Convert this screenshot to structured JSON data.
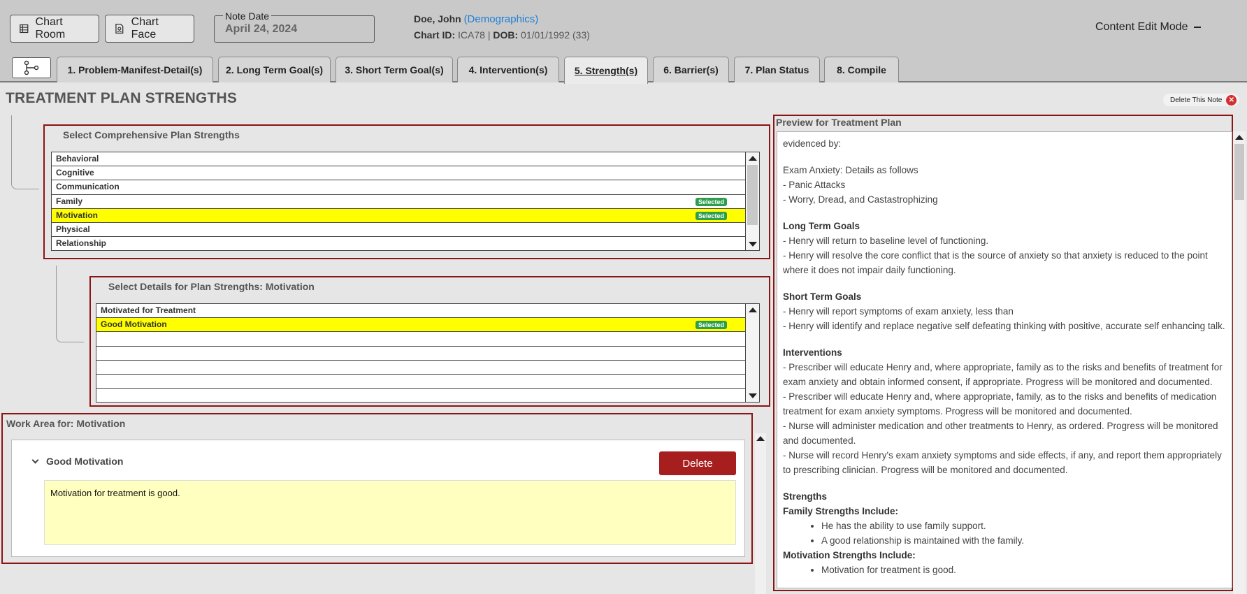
{
  "header": {
    "chart_room_label": "Chart Room",
    "chart_face_label": "Chart Face",
    "note_date_label": "Note Date",
    "note_date_value": "April 24, 2024",
    "patient_name": "Doe, John",
    "demographics_link": "(Demographics)",
    "chart_id_label": "Chart ID:",
    "chart_id_value": "ICA78",
    "separator": "|",
    "dob_label": "DOB:",
    "dob_value": "01/01/1992 (33)",
    "edit_mode_label": "Content Edit Mode"
  },
  "tabs": [
    {
      "label": "1. Problem-Manifest-Detail(s)"
    },
    {
      "label": "2. Long Term Goal(s)"
    },
    {
      "label": "3. Short Term Goal(s)"
    },
    {
      "label": "4. Intervention(s)"
    },
    {
      "label": "5. Strength(s)"
    },
    {
      "label": "6. Barrier(s)"
    },
    {
      "label": "7. Plan Status"
    },
    {
      "label": "8. Compile"
    }
  ],
  "active_tab_index": 4,
  "page_title": "TREATMENT PLAN STRENGTHS",
  "delete_note_label": "Delete This Note",
  "strengths_panel": {
    "title": "Select Comprehensive Plan Strengths",
    "items": [
      {
        "label": "Behavioral",
        "badge": ""
      },
      {
        "label": "Cognitive",
        "badge": ""
      },
      {
        "label": "Communication",
        "badge": ""
      },
      {
        "label": "Family",
        "badge": "Selected"
      },
      {
        "label": "Motivation",
        "badge": "Selected"
      },
      {
        "label": "Physical",
        "badge": ""
      },
      {
        "label": "Relationship",
        "badge": ""
      }
    ]
  },
  "details_panel": {
    "title": "Select Details for Plan Strengths: Motivation",
    "items": [
      {
        "label": "Motivated for Treatment",
        "badge": ""
      },
      {
        "label": "Good Motivation",
        "badge": "Selected"
      }
    ]
  },
  "work_area": {
    "title": "Work Area for: Motivation",
    "item_title": "Good Motivation",
    "delete_label": "Delete",
    "text": "Motivation for treatment is good."
  },
  "preview": {
    "title": "Preview for Treatment Plan",
    "evidenced": "evidenced by:",
    "problem": "Exam Anxiety: Details as follows",
    "manifest_1": "- Panic Attacks",
    "manifest_2": "- Worry, Dread, and Castastrophizing",
    "ltg_heading": "Long Term Goals",
    "ltg_1": "-   Henry will return to baseline level of functioning.",
    "ltg_2": "-   Henry will resolve the core conflict that is the source of anxiety so that anxiety is reduced to the point where it does not impair daily functioning.",
    "stg_heading": "Short Term Goals",
    "stg_1": "-   Henry will report symptoms of exam anxiety, less than",
    "stg_2": "-   Henry will identify and replace negative self defeating thinking with positive, accurate self enhancing talk.",
    "int_heading": "Interventions",
    "int_1": "-   Prescriber will educate Henry and, where appropriate, family as to the risks and benefits of treatment for exam anxiety and obtain informed consent, if appropriate. Progress will be monitored and documented.",
    "int_2": "-   Prescriber will educate Henry and, where appropriate, family, as to the risks and benefits of medication treatment for exam anxiety symptoms. Progress will be monitored and documented.",
    "int_3": "-   Nurse will administer medication and other treatments to Henry, as ordered. Progress will be monitored and documented.",
    "int_4": "-   Nurse will record Henry's exam anxiety symptoms and side effects, if any, and report them appropriately to prescribing clinician. Progress will be monitored and documented.",
    "str_heading": "Strengths",
    "family_heading": "Family Strengths Include:",
    "family_1": "He has the ability to use family support.",
    "family_2": "A good relationship is maintained with the family.",
    "motivation_heading": "Motivation Strengths Include:",
    "motivation_1": "Motivation for treatment is good."
  },
  "colors": {
    "panel_border": "#8b1414",
    "highlight": "#ffff00",
    "badge": "#2e9e4e",
    "delete_button": "#a61e1e",
    "link": "#1e7fd6"
  }
}
